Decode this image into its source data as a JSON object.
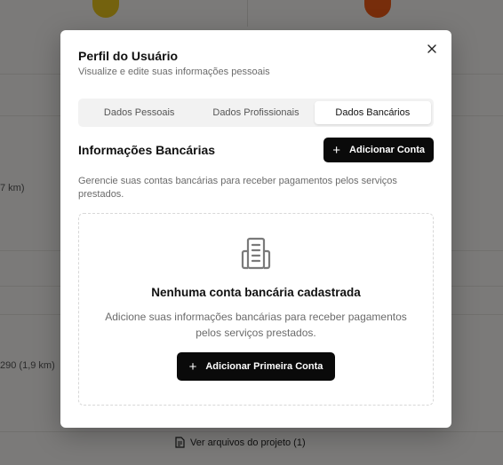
{
  "background": {
    "distance_left_1": "7 km)",
    "distance_left_2": "290 (1,9 km)",
    "footer_link": "Ver arquivos do projeto (1)"
  },
  "modal": {
    "title": "Perfil do Usuário",
    "subtitle": "Visualize e edite suas informações pessoais",
    "close_icon": "x",
    "tabs": [
      {
        "label": "Dados Pessoais",
        "active": false
      },
      {
        "label": "Dados Profissionais",
        "active": false
      },
      {
        "label": "Dados Bancários",
        "active": true
      }
    ],
    "section_title": "Informações Bancárias",
    "add_account_label": "Adicionar Conta",
    "section_desc": "Gerencie suas contas bancárias para receber pagamentos pelos serviços prestados.",
    "empty": {
      "icon": "building-icon",
      "title": "Nenhuma conta bancária cadastrada",
      "desc": "Adicione suas informações bancárias para receber pagamentos pelos serviços prestados.",
      "button_label": "Adicionar Primeira Conta"
    }
  },
  "colors": {
    "primary_button": "#0a0a0a",
    "accent_yellow": "#e8c51d",
    "accent_orange": "#ef5a17"
  }
}
